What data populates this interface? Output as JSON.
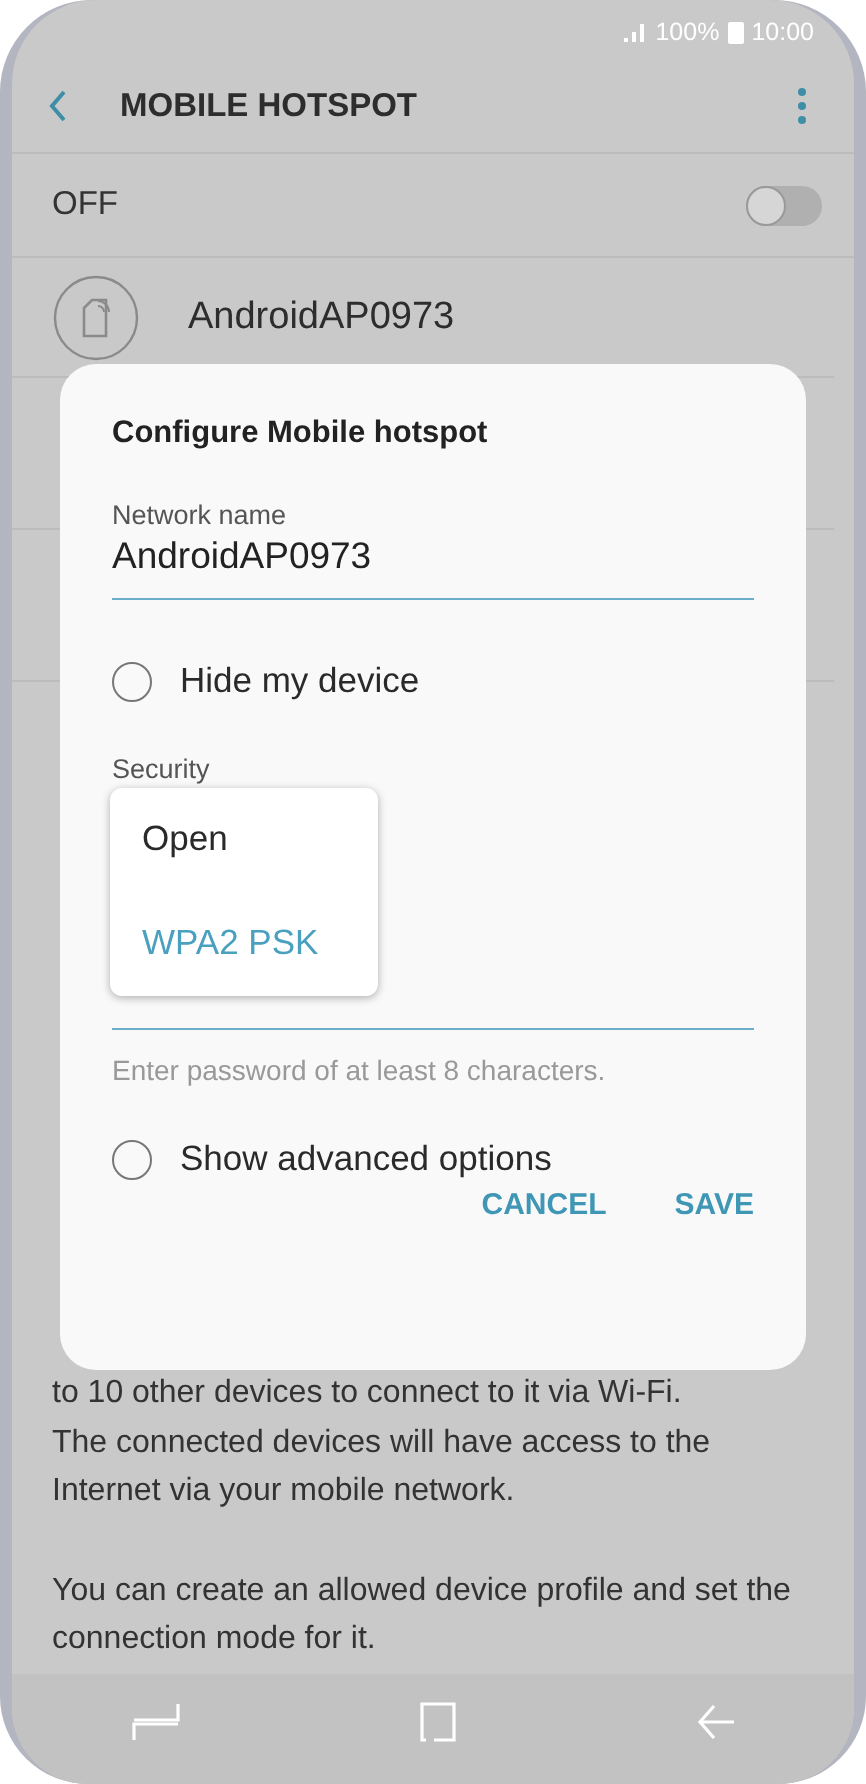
{
  "status_bar": {
    "battery": "100%",
    "time": "10:00"
  },
  "header": {
    "title": "MOBILE HOTSPOT"
  },
  "master_switch": {
    "label": "OFF",
    "on": false
  },
  "device": {
    "name": "AndroidAP0973"
  },
  "description_lines": [
    "to 10 other devices to connect to it via Wi-Fi.",
    "The connected devices will have access to the",
    "Internet via your mobile network."
  ],
  "note": "You can create an allowed device profile and set the connection mode for it.",
  "dialog": {
    "title": "Configure Mobile hotspot",
    "network_name_label": "Network name",
    "network_name": "AndroidAP0973",
    "options": [
      {
        "label": "Hide my device",
        "checked": false
      },
      {
        "label": "Show advanced options",
        "checked": false
      }
    ],
    "security_label": "Security",
    "security_options": [
      {
        "label": "Open",
        "selected": false
      },
      {
        "label": "WPA2 PSK",
        "selected": true
      }
    ],
    "password_hint": "Enter password of at least 8 characters.",
    "buttons": [
      "CANCEL",
      "SAVE"
    ]
  }
}
